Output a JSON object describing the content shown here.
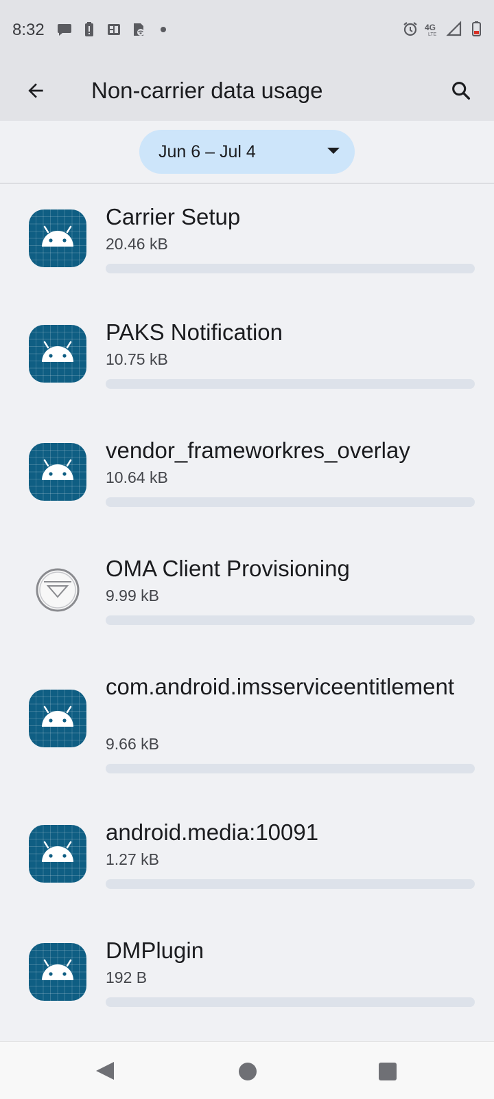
{
  "status_bar": {
    "time": "8:32",
    "left_icons": [
      "chat-bubble-icon",
      "battery-alert-icon",
      "sim-toolkit-icon",
      "wifi-sim-icon",
      "dot-icon"
    ],
    "right_icons": [
      "alarm-icon",
      "4g-lte-icon",
      "signal-icon",
      "battery-icon"
    ],
    "network_label": "4G"
  },
  "app_bar": {
    "title": "Non-carrier data usage",
    "back_icon": "arrow-back-icon",
    "search_icon": "search-icon"
  },
  "date_selector": {
    "value": "Jun 6 – Jul 4",
    "icon": "dropdown-arrow-icon"
  },
  "apps": [
    {
      "name": "Carrier Setup",
      "size": "20.46 kB",
      "usage_fraction": 0,
      "icon": "android-app-icon"
    },
    {
      "name": "PAKS Notification",
      "size": "10.75 kB",
      "usage_fraction": 0,
      "icon": "android-app-icon"
    },
    {
      "name": "vendor_frameworkres_overlay",
      "size": "10.64 kB",
      "usage_fraction": 0,
      "icon": "android-app-icon"
    },
    {
      "name": "OMA Client Provisioning",
      "size": "9.99 kB",
      "usage_fraction": 0,
      "icon": "download-circle-icon"
    },
    {
      "name": "com.android.imsserviceentitlement",
      "size": "9.66 kB",
      "usage_fraction": 0,
      "icon": "android-app-icon"
    },
    {
      "name": "android.media:10091",
      "size": "1.27 kB",
      "usage_fraction": 0,
      "icon": "android-app-icon"
    },
    {
      "name": "DMPlugin",
      "size": "192 B",
      "usage_fraction": 0,
      "icon": "android-app-icon"
    }
  ],
  "nav_bar": {
    "back": "nav-back-icon",
    "home": "nav-home-icon",
    "recents": "nav-recents-icon"
  },
  "colors": {
    "header_bg": "#e2e3e7",
    "page_bg": "#f0f1f4",
    "pill_bg": "#cde5fa",
    "android_icon_bg": "#0f5e83",
    "usage_track": "#dde2ea"
  }
}
